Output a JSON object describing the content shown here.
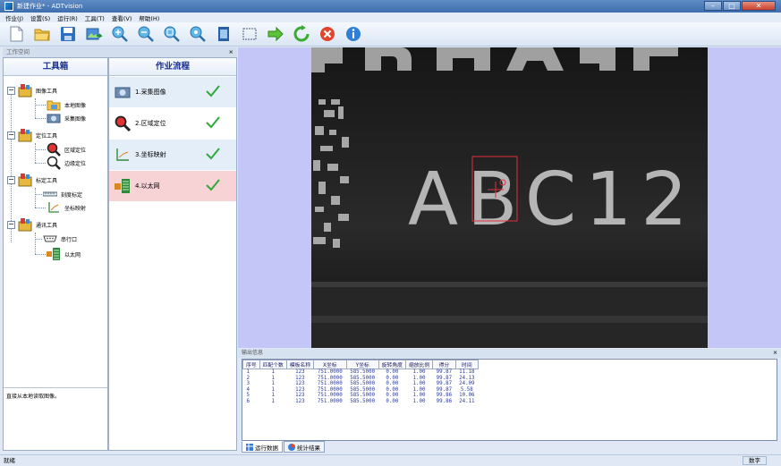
{
  "window": {
    "title": "新建作业* - ADTvision"
  },
  "menu": [
    "作业(J)",
    "设置(S)",
    "运行(R)",
    "工具(T)",
    "查看(V)",
    "帮助(H)"
  ],
  "toolbar_icons": [
    "new-file-icon",
    "open-folder-icon",
    "save-icon",
    "import-image-icon",
    "zoom-in-icon",
    "zoom-out-icon",
    "zoom-fit-icon",
    "zoom-original-icon",
    "film-icon",
    "select-rect-icon",
    "run-arrow-icon",
    "loop-run-icon",
    "stop-icon",
    "info-icon"
  ],
  "dock": {
    "title": "工作空间",
    "close": "×"
  },
  "toolbox": {
    "header": "工具箱",
    "groups": [
      {
        "label": "图像工具",
        "items": [
          "本地图像",
          "采集图像"
        ]
      },
      {
        "label": "定位工具",
        "items": [
          "区域定位",
          "边缘定位"
        ]
      },
      {
        "label": "标定工具",
        "items": [
          "刻度标定",
          "坐标映射"
        ]
      },
      {
        "label": "通讯工具",
        "items": [
          "串行口",
          "以太网"
        ]
      }
    ]
  },
  "status_text": "直接从本地读取图像。",
  "workflow": {
    "header": "作业流程",
    "steps": [
      {
        "label": "1.采集图像",
        "bg": "#e4eef8"
      },
      {
        "label": "2.区域定位",
        "bg": "#ffffff"
      },
      {
        "label": "3.坐标映射",
        "bg": "#e4eef8"
      },
      {
        "label": "4.以太网",
        "bg": "#f7d3d6"
      }
    ]
  },
  "camera": {
    "text": "ABC12"
  },
  "output": {
    "title": "输出信息",
    "close": "×",
    "columns": [
      "序号",
      "匹配个数",
      "模板名称",
      "X坐标",
      "Y坐标",
      "旋转角度",
      "缩放比例",
      "得分",
      "时间"
    ],
    "rows": [
      [
        "1",
        "1",
        "123",
        "751.0000",
        "585.5000",
        "0.00",
        "1.00",
        "99.87",
        "11.18"
      ],
      [
        "2",
        "1",
        "123",
        "751.0000",
        "585.5000",
        "0.00",
        "1.00",
        "99.87",
        "24.13"
      ],
      [
        "3",
        "1",
        "123",
        "751.0000",
        "585.5000",
        "0.00",
        "1.00",
        "99.87",
        "24.09"
      ],
      [
        "4",
        "1",
        "123",
        "751.0000",
        "585.5000",
        "0.00",
        "1.00",
        "99.87",
        "5.58"
      ],
      [
        "5",
        "1",
        "123",
        "751.0000",
        "585.5000",
        "0.00",
        "1.00",
        "99.86",
        "10.06"
      ],
      [
        "6",
        "1",
        "123",
        "751.0000",
        "585.5000",
        "0.00",
        "1.00",
        "99.86",
        "24.11"
      ]
    ]
  },
  "tabs": [
    "运行数据",
    "统计结果"
  ],
  "statusbar": {
    "left": "就绪",
    "right": "数字"
  },
  "colors": {
    "accent": "#1a2f8f",
    "check": "#2eaa3a",
    "selection": "#e0303a",
    "image_bg": "#c4c6f8"
  }
}
